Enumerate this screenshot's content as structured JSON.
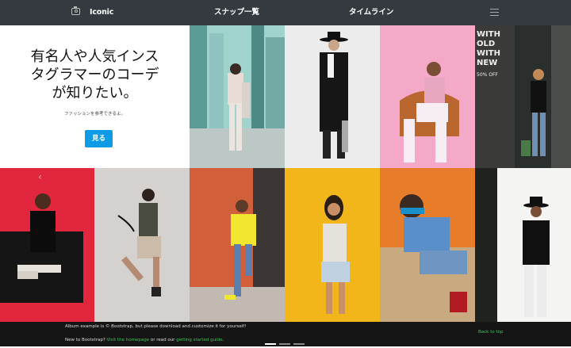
{
  "nav": {
    "brand": "Iconic",
    "brand_icon": "camera-icon",
    "snap_list": "スナップ一覧",
    "timeline": "タイムライン",
    "menu_icon": "hamburger-menu-icon"
  },
  "hero": {
    "title_lines": [
      "有名人や人気インス",
      "タグラマーのコーデ",
      "が知りたい。"
    ],
    "subtitle": "ファッションを参考できるよ。",
    "button": "見る"
  },
  "carousel": {
    "prev_icon": "chevron-left-icon"
  },
  "footer": {
    "line1": "Album example is © Bootstrap, but please download and customize it for yourself!",
    "line2_prefix": "New to Bootstrap? ",
    "line2_link1": "Visit the homepage",
    "line2_mid": " or read our ",
    "line2_link2": "getting started guide",
    "line2_suffix": ".",
    "back_to_top": "Back to top"
  },
  "photo_tiles": [
    "city-skyline-woman-photo",
    "man-black-coat-hat-photo",
    "woman-pink-chair-photo",
    "storefront-woman-photo",
    "man-red-wall-sofa-photo",
    "woman-jumping-photo",
    "man-yellow-shirt-orange-wall-photo",
    "woman-yellow-wall-photo",
    "man-sunglasses-crouching-photo",
    "man-black-hat-white-wall-photo"
  ],
  "storefront_text": [
    "WITH",
    "OLD",
    "WITH",
    "NEW",
    "50% OFF"
  ],
  "colors": {
    "nav_bg": "#343a40",
    "button": "#0d9be5",
    "footer_bg": "#151515",
    "link": "#3ac457"
  }
}
